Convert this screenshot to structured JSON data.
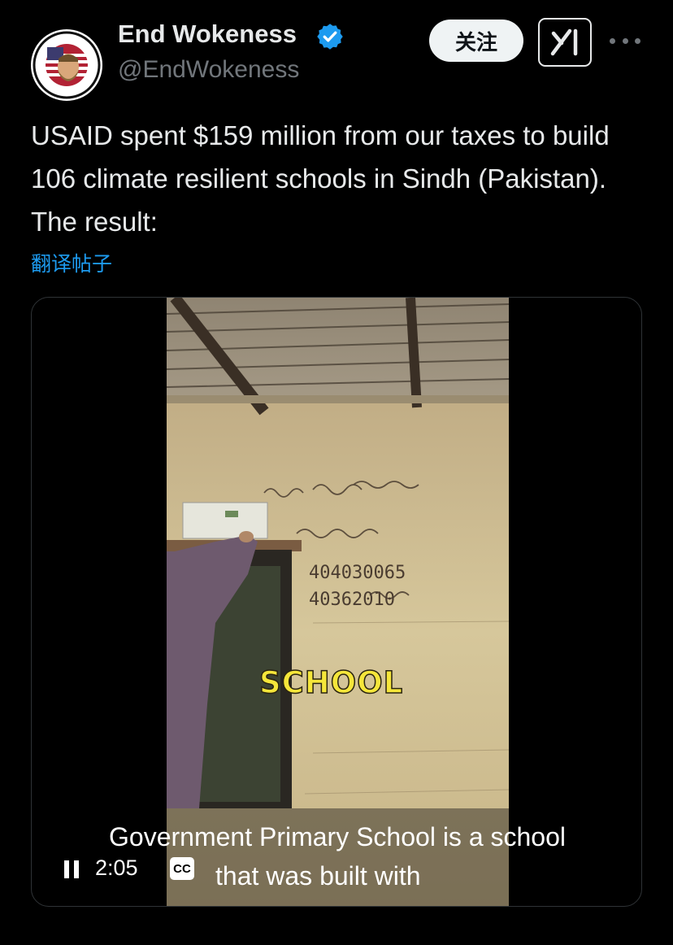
{
  "author": {
    "display_name": "End Wokeness",
    "handle": "@EndWokeness",
    "avatar_text_top": "I SUPPORT THE",
    "avatar_text_bottom": "FORMER THINGS"
  },
  "actions": {
    "follow_label": "关注"
  },
  "tweet": {
    "text": "USAID spent $159 million from our taxes to build 106 climate resilient schools in Sindh (Pakistan). The result:",
    "translate_label": "翻译帖子"
  },
  "video": {
    "overlay_word": "SCHOOL",
    "caption_line1": "Government Primary School is a school",
    "caption_line2": "that was built with",
    "time": "2:05",
    "cc_label": "CC",
    "wall_text": [
      "404030065",
      "40362010"
    ]
  },
  "colors": {
    "background": "#000000",
    "accent": "#1d9bf0",
    "verified": "#1d9bf0",
    "secondary_text": "#71767b",
    "primary_text": "#e7e9ea"
  }
}
